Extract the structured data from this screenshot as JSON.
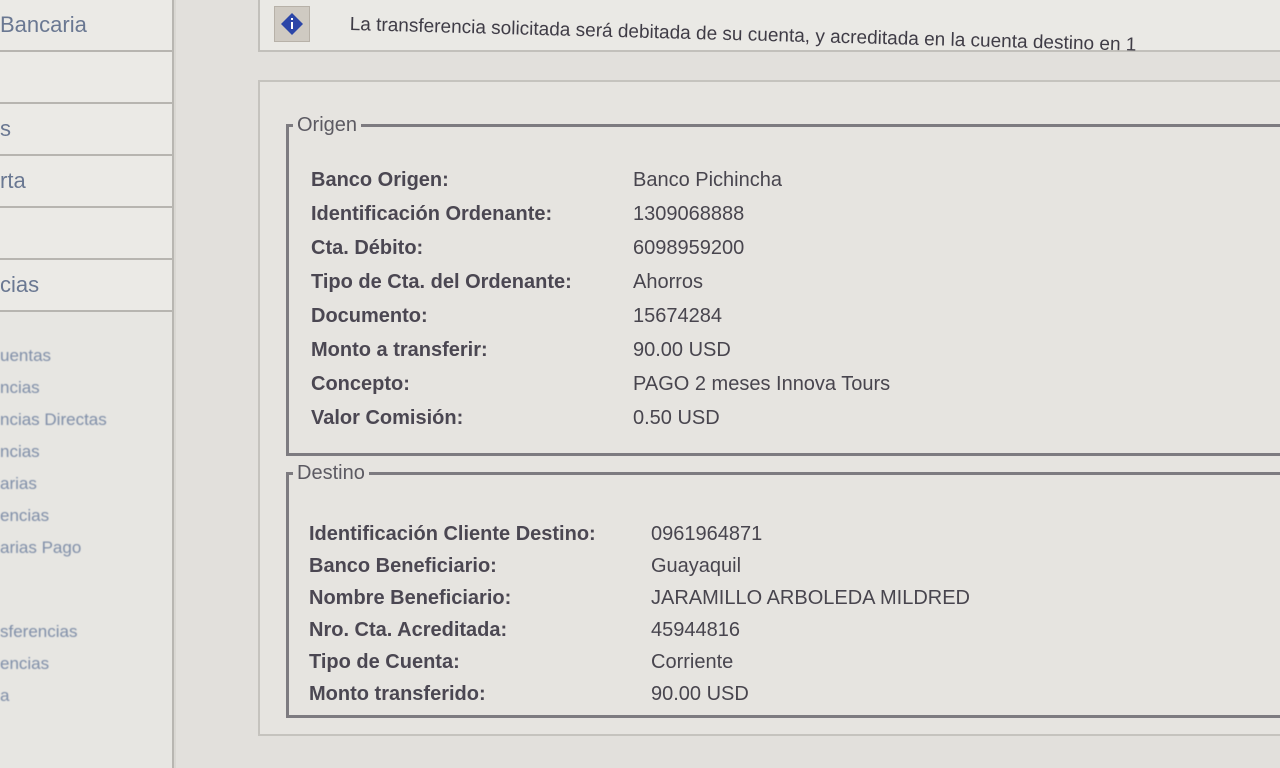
{
  "sidebar": {
    "blocks": [
      "Bancaria",
      "",
      "s",
      "rta",
      "",
      "cias"
    ],
    "links": [
      "uentas",
      "ncias",
      "ncias Directas",
      "ncias",
      "arias",
      "encias",
      "arias Pago",
      "",
      "",
      "sferencias",
      "encias",
      "a"
    ]
  },
  "notice": {
    "text": "La transferencia solicitada será debitada de su cuenta, y acreditada en la cuenta destino en 1"
  },
  "origen": {
    "legend": "Origen",
    "rows": [
      {
        "label": "Banco Origen:",
        "value": "Banco Pichincha"
      },
      {
        "label": "Identificación Ordenante:",
        "value": "1309068888"
      },
      {
        "label": "Cta. Débito:",
        "value": "6098959200"
      },
      {
        "label": "Tipo de Cta. del Ordenante:",
        "value": "Ahorros"
      },
      {
        "label": "Documento:",
        "value": "15674284"
      },
      {
        "label": "Monto a transferir:",
        "value": "90.00 USD"
      },
      {
        "label": "Concepto:",
        "value": "PAGO 2 meses Innova Tours"
      },
      {
        "label": "Valor Comisión:",
        "value": "0.50 USD"
      }
    ]
  },
  "destino": {
    "legend": "Destino",
    "rows": [
      {
        "label": "Identificación Cliente Destino:",
        "value": "0961964871"
      },
      {
        "label": "Banco Beneficiario:",
        "value": "Guayaquil"
      },
      {
        "label": "Nombre Beneficiario:",
        "value": "JARAMILLO ARBOLEDA MILDRED"
      },
      {
        "label": "Nro. Cta. Acreditada:",
        "value": "45944816"
      },
      {
        "label": "Tipo de Cuenta:",
        "value": "Corriente"
      },
      {
        "label": "Monto transferido:",
        "value": "90.00 USD"
      }
    ]
  }
}
